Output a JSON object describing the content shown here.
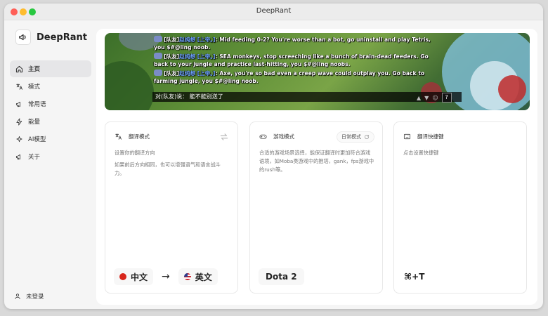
{
  "window": {
    "title": "DeepRant"
  },
  "sidebar": {
    "app_name": "DeepRant",
    "items": [
      {
        "label": "主页",
        "icon": "home-icon",
        "active": true
      },
      {
        "label": "模式",
        "icon": "translate-icon",
        "active": false
      },
      {
        "label": "常用语",
        "icon": "megaphone-icon",
        "active": false
      },
      {
        "label": "能量",
        "icon": "lightning-icon",
        "active": false
      },
      {
        "label": "AI模型",
        "icon": "sparkle-icon",
        "active": false
      },
      {
        "label": "关于",
        "icon": "megaphone-icon",
        "active": false
      }
    ],
    "user_label": "未登录"
  },
  "banner": {
    "chat_lines": [
      {
        "channel": "[队友]",
        "name": "赵纯想",
        "hero": "[上帝。]",
        "text": ": Mid feeding 0-2? You're worse than a bot, go uninstall and play Tetris, you $#@ling noob."
      },
      {
        "channel": "[队友]",
        "name": "赵纯想",
        "hero": "[上帝。]",
        "text": ": SEA monkeys, stop screeching like a bunch of brain-dead feeders. Go back to your jungle and practice last-hitting, you $#@ling noobs."
      },
      {
        "channel": "[队友]",
        "name": "赵纯想",
        "hero": "[上帝。]",
        "text": ": Axe, you're so bad even a creep wave could outplay you. Go back to farming jungle, you $#@ling noob."
      }
    ],
    "input_text": "对(队友)说：  能不能别送了",
    "help_label": "?"
  },
  "cards": {
    "translate": {
      "title": "翻译模式",
      "desc1": "设置你的翻译方向",
      "desc2": "如果前后方向相同，也可以增强语气和语言战斗力。",
      "source_lang": "中文",
      "arrow": "→",
      "target_lang": "英文"
    },
    "game": {
      "title": "游戏模式",
      "mode_label": "日常模式",
      "desc": "合适的游戏场景选择，能保证翻译时更加符合游戏语境，如Moba类游戏中的推塔，gank，fps游戏中的rush等。",
      "game_name": "Dota 2"
    },
    "shortcut": {
      "title": "翻译快捷键",
      "desc": "点击设置快捷键",
      "key": "⌘+T"
    }
  }
}
